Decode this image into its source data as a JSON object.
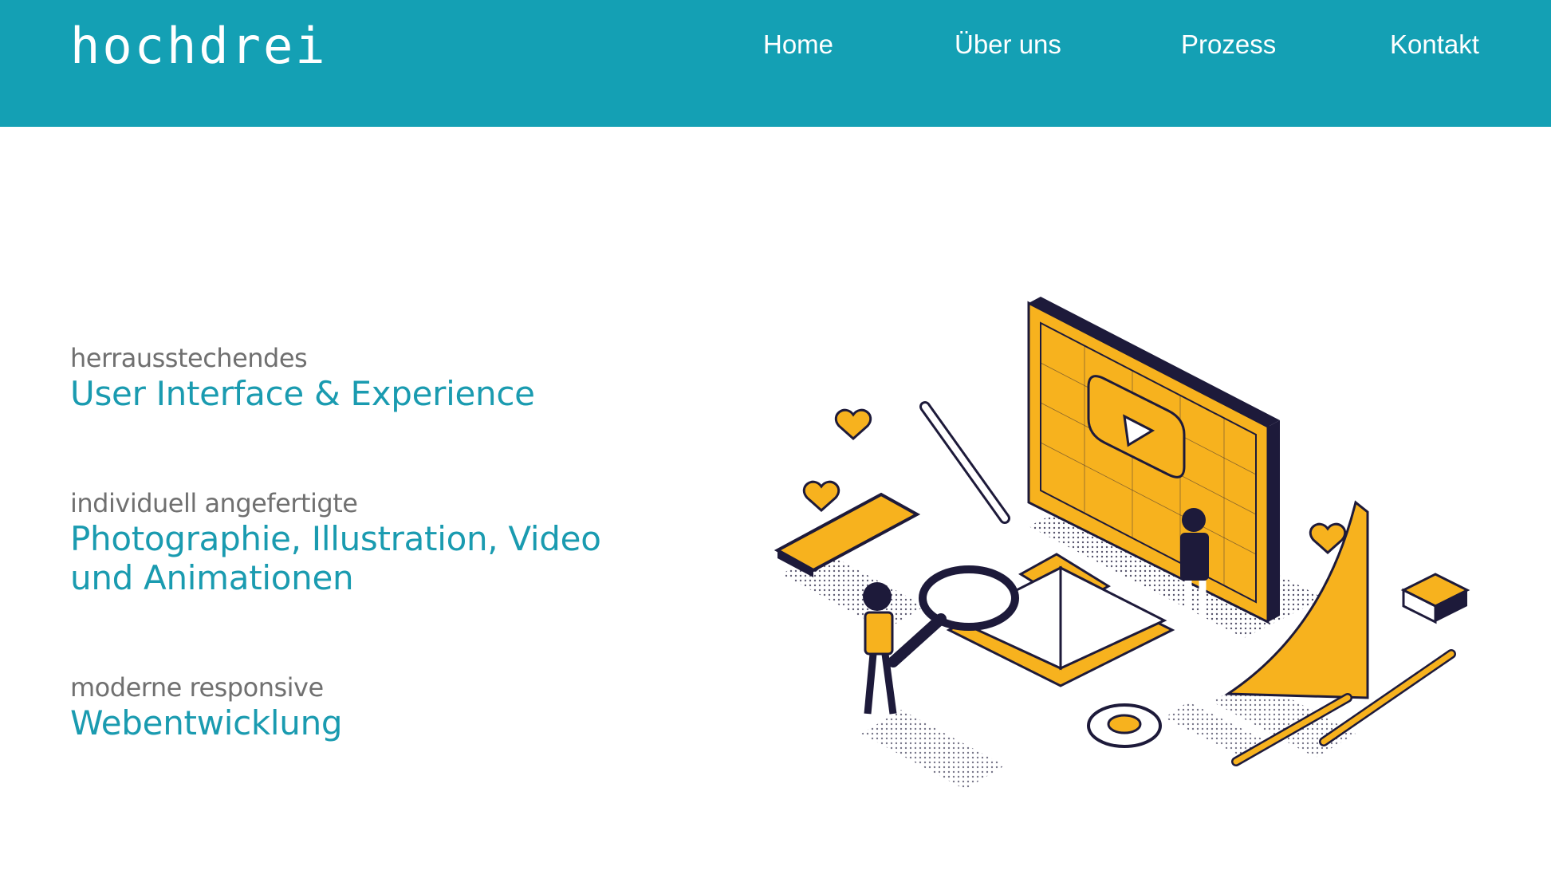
{
  "brand": {
    "logo_text": "hochdrei"
  },
  "nav": {
    "items": [
      {
        "label": "Home"
      },
      {
        "label": "Über uns"
      },
      {
        "label": "Prozess"
      },
      {
        "label": "Kontakt"
      }
    ]
  },
  "services": [
    {
      "kicker": "herrausstechendes",
      "headline_lines": [
        "User Interface & Experience"
      ]
    },
    {
      "kicker": "individuell angefertigte",
      "headline_lines": [
        "Photographie, Illustration, Video",
        "und Animationen"
      ]
    },
    {
      "kicker": "moderne responsive",
      "headline_lines": [
        "Webentwicklung"
      ]
    }
  ],
  "colors": {
    "header_bg": "#14a0b4",
    "accent_text": "#1a9bb0",
    "kicker_text": "#707070",
    "illustration_yellow": "#f7b21e",
    "illustration_navy": "#1d1a3a"
  },
  "illustration": {
    "icons": [
      "monitor-icon",
      "play-icon",
      "smartphone-icon",
      "heart-icon",
      "pen-icon",
      "magnifier-icon",
      "book-icon",
      "tape-measure-icon",
      "pencil-icon",
      "ruler-icon",
      "box-icon",
      "person-icon"
    ]
  }
}
